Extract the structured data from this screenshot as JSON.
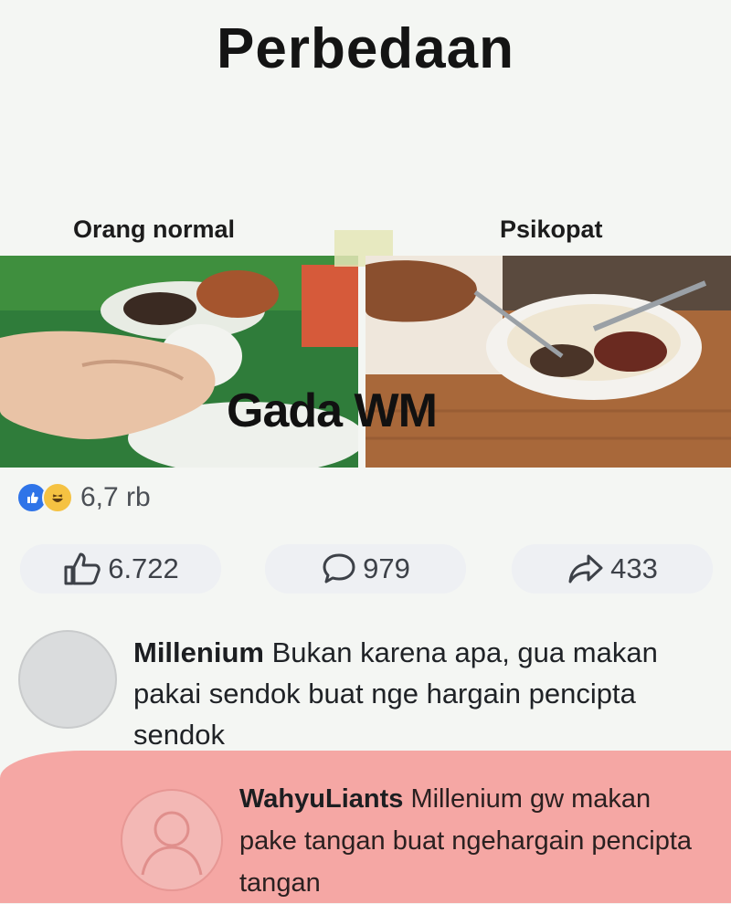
{
  "post": {
    "title": "Perbedaan",
    "caption_left": "Orang normal",
    "caption_right": "Psikopat",
    "watermark": "Gada WM"
  },
  "reactions": {
    "total": "6,7 rb",
    "like_count": "6.722",
    "comment_count": "979",
    "share_count": "433"
  },
  "comments": [
    {
      "author": "Millenium",
      "text": "Bukan karena apa, gua makan pakai sendok buat nge hargain pencipta sendok"
    },
    {
      "author": "WahyuLiants",
      "text": "Millenium gw makan pake tangan buat ngehargain pencipta tangan"
    }
  ],
  "colors": {
    "background": "#f4f6f3",
    "highlight": "#f5a7a4",
    "like_blue": "#2f74e8"
  },
  "icons": [
    "like-reaction-icon",
    "haha-reaction-icon",
    "thumbs-up-icon",
    "comment-icon",
    "share-icon"
  ]
}
